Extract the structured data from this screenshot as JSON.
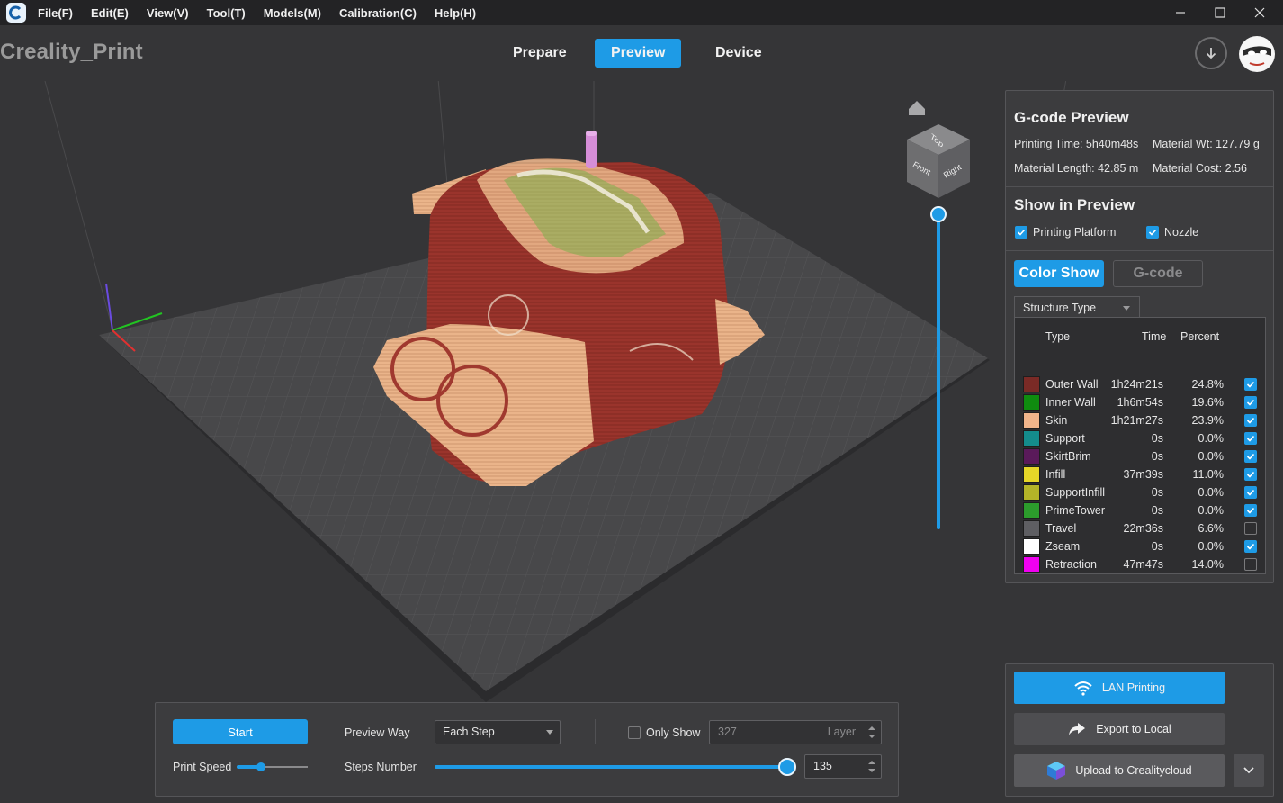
{
  "app": {
    "brand": "Creality_Print"
  },
  "menu": {
    "items": [
      "File(F)",
      "Edit(E)",
      "View(V)",
      "Tool(T)",
      "Models(M)",
      "Calibration(C)",
      "Help(H)"
    ]
  },
  "tabs": {
    "prepare": "Prepare",
    "preview": "Preview",
    "device": "Device",
    "active": "Preview"
  },
  "view_cube": {
    "top": "Top",
    "front": "Front",
    "right": "Right"
  },
  "gcode_preview": {
    "title": "G-code Preview",
    "printing_time": "Printing Time: 5h40m48s",
    "material_wt": "Material Wt: 127.79 g",
    "material_length": "Material Length: 42.85 m",
    "material_cost": "Material Cost: 2.56"
  },
  "show_in_preview": {
    "title": "Show in Preview",
    "printing_platform": "Printing Platform",
    "printing_platform_checked": true,
    "nozzle": "Nozzle",
    "nozzle_checked": true
  },
  "color_mode": {
    "color_show": "Color Show",
    "gcode": "G-code",
    "active": "Color Show"
  },
  "structure": {
    "dropdown": "Structure Type",
    "headers": {
      "type": "Type",
      "time": "Time",
      "percent": "Percent"
    },
    "rows": [
      {
        "name": "Outer Wall",
        "time": "1h24m21s",
        "percent": "24.8%",
        "color": "#7a2a26",
        "checked": true
      },
      {
        "name": "Inner Wall",
        "time": "1h6m54s",
        "percent": "19.6%",
        "color": "#0f8c0f",
        "checked": true
      },
      {
        "name": "Skin",
        "time": "1h21m27s",
        "percent": "23.9%",
        "color": "#f0b48a",
        "checked": true
      },
      {
        "name": "Support",
        "time": "0s",
        "percent": "0.0%",
        "color": "#148c8c",
        "checked": true
      },
      {
        "name": "SkirtBrim",
        "time": "0s",
        "percent": "0.0%",
        "color": "#5a1a5a",
        "checked": true
      },
      {
        "name": "Infill",
        "time": "37m39s",
        "percent": "11.0%",
        "color": "#e6d628",
        "checked": true
      },
      {
        "name": "SupportInfill",
        "time": "0s",
        "percent": "0.0%",
        "color": "#b4b428",
        "checked": true
      },
      {
        "name": "PrimeTower",
        "time": "0s",
        "percent": "0.0%",
        "color": "#2c9c2c",
        "checked": true
      },
      {
        "name": "Travel",
        "time": "22m36s",
        "percent": "6.6%",
        "color": "#5e5e62",
        "checked": false
      },
      {
        "name": "Zseam",
        "time": "0s",
        "percent": "0.0%",
        "color": "#ffffff",
        "checked": true
      },
      {
        "name": "Retraction",
        "time": "47m47s",
        "percent": "14.0%",
        "color": "#f000f0",
        "checked": false
      }
    ]
  },
  "controls": {
    "start": "Start",
    "print_speed": "Print Speed",
    "preview_way_label": "Preview Way",
    "preview_way_value": "Each Step",
    "only_show": "Only Show",
    "only_show_checked": false,
    "layer_value": "327",
    "layer_unit": "Layer",
    "steps_number_label": "Steps Number",
    "steps_value": "135"
  },
  "actions": {
    "lan_printing": "LAN Printing",
    "export_local": "Export to Local",
    "upload_cloud": "Upload to Crealitycloud"
  },
  "colors": {
    "accent": "#1e9be6",
    "panel": "#3c3c3e",
    "background": "#353537"
  }
}
